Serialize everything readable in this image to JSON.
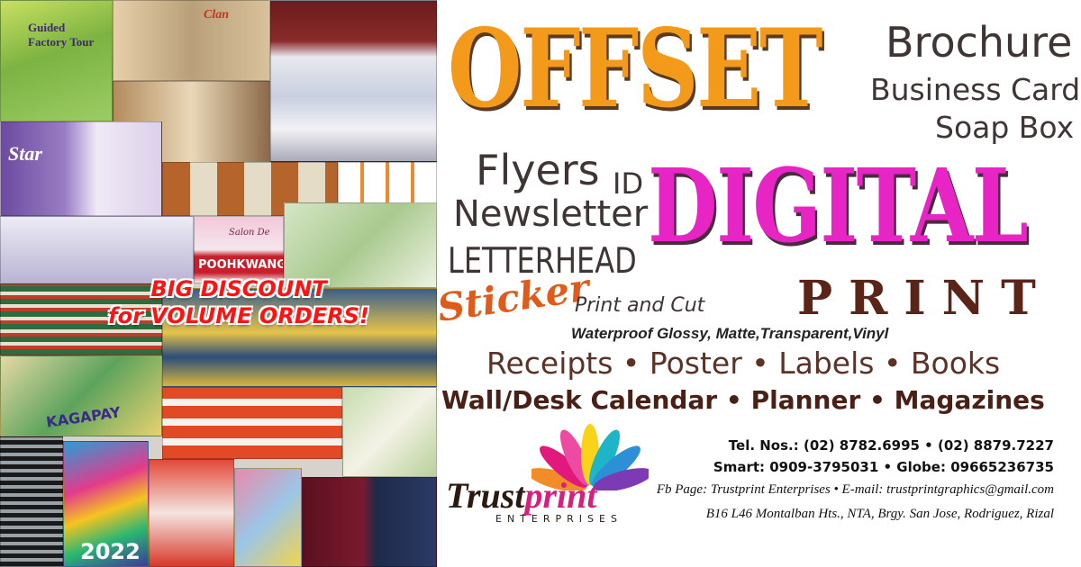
{
  "collage": {
    "promo_line1": "BIG DISCOUNT",
    "promo_line2": "for  VOLUME ORDERS!",
    "sample_texts": {
      "brochure": "Guided Factory Tour",
      "clan": "Clan",
      "star": "Star",
      "salon_line1": "Salon De",
      "salon_line2": "POOHKWANG",
      "kagapay": "KAGAPAY",
      "year": "2022"
    }
  },
  "headline": {
    "offset": "OFFSET",
    "digital": "DIGITAL",
    "print": "PRINT"
  },
  "products": {
    "brochure": "Brochure",
    "business_card": "Business Card",
    "soap_box": "Soap Box",
    "flyers": "Flyers",
    "id": "ID",
    "newsletter": "Newsletter",
    "letterhead": "LETTERHEAD",
    "sticker": "Sticker",
    "print_and_cut": "Print and Cut",
    "sticker_types": "Waterproof Glossy, Matte,Transparent,Vinyl",
    "row1": "Receipts •  Poster  •  Labels • Books",
    "row2": "Wall/Desk Calendar • Planner • Magazines"
  },
  "logo": {
    "name_part1": "Trust",
    "name_part2": "print",
    "subtitle": "ENTERPRISES"
  },
  "contact": {
    "tel": "Tel. Nos.: (02) 8782.6995  • (02) 8879.7227",
    "mobile": "Smart: 0909-3795031 • Globe: 09665236735",
    "social": "Fb Page: Trustprint Enterprises • E-mail: trustprintgraphics@gmail.com",
    "address": "B16 L46 Montalban Hts., NTA, Brgy. San Jose, Rodriguez, Rizal"
  },
  "colors": {
    "offset": "#f39a1a",
    "digital": "#e724c4",
    "print": "#5a2418",
    "promo": "#ff1212",
    "sticker": "#e05a1a"
  }
}
